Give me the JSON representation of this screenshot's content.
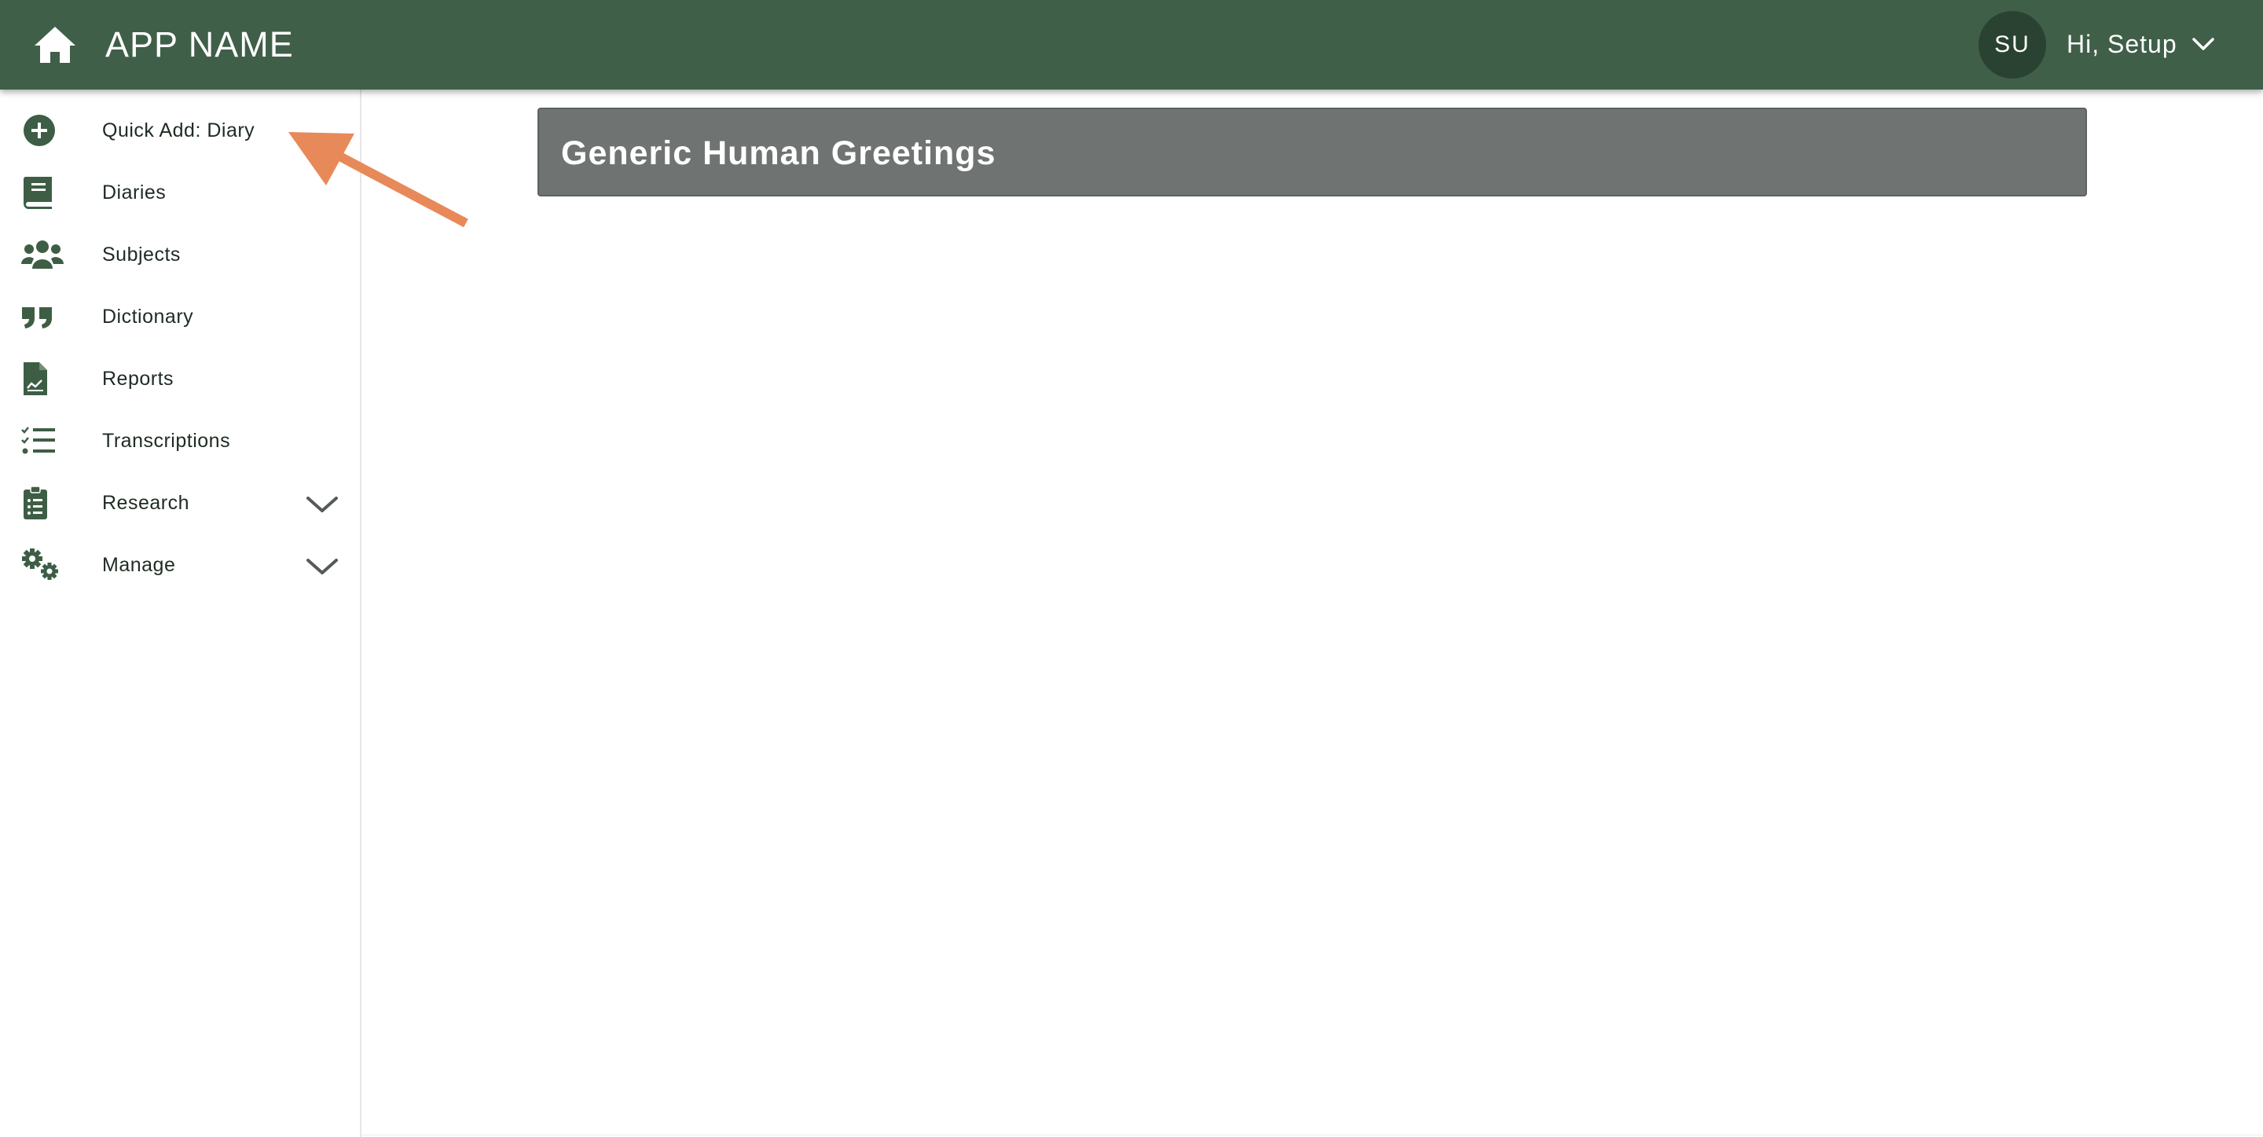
{
  "header": {
    "app_title": "APP NAME",
    "avatar_initials": "SU",
    "user_greeting": "Hi, Setup",
    "home_icon": "home-icon",
    "dropdown_icon": "chevron-down-icon"
  },
  "sidebar": {
    "items": [
      {
        "label": "Quick Add: Diary",
        "icon": "plus-circle-icon"
      },
      {
        "label": "Diaries",
        "icon": "book-icon"
      },
      {
        "label": "Subjects",
        "icon": "users-icon"
      },
      {
        "label": "Dictionary",
        "icon": "quote-icon"
      },
      {
        "label": "Reports",
        "icon": "file-chart-icon"
      },
      {
        "label": "Transcriptions",
        "icon": "tasks-list-icon"
      },
      {
        "label": "Research",
        "icon": "clipboard-list-icon",
        "expandable": true
      },
      {
        "label": "Manage",
        "icon": "cogs-icon",
        "expandable": true
      }
    ]
  },
  "main": {
    "page_title": "Generic Human Greetings"
  },
  "colors": {
    "topbar": "#3f5f48",
    "accent_dark": "#2a4231",
    "icon": "#3d5e45",
    "header_card": "#6f7372",
    "annotation_arrow": "#e8895a"
  }
}
